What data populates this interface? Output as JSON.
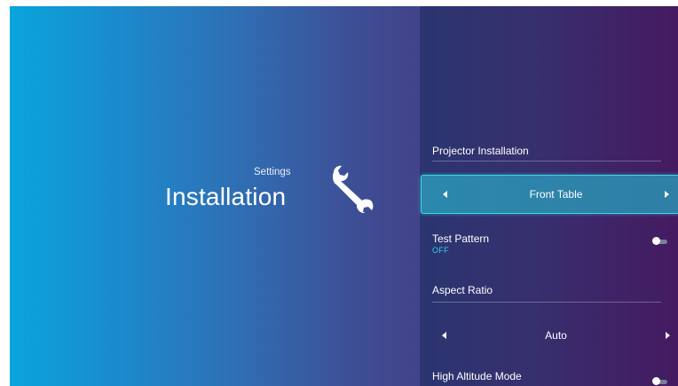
{
  "header": {
    "breadcrumb": "Settings",
    "title": "Installation",
    "icon": "wrench-icon"
  },
  "menu": {
    "projector_installation": {
      "label": "Projector Installation",
      "value": "Front Table"
    },
    "test_pattern": {
      "label": "Test Pattern",
      "status": "OFF",
      "enabled": false
    },
    "aspect_ratio": {
      "label": "Aspect Ratio",
      "value": "Auto"
    },
    "high_altitude_mode": {
      "label": "High Altitude Mode",
      "enabled": false
    }
  },
  "colors": {
    "focus_border": "#39d6e6",
    "status_text": "#2ad3f0"
  }
}
